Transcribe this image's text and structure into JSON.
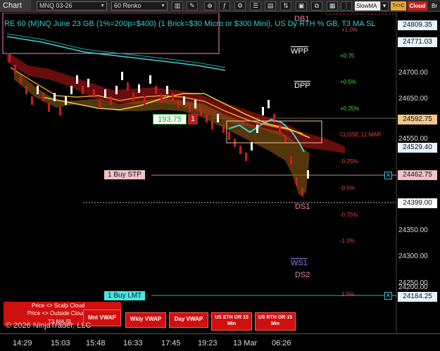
{
  "toolbar": {
    "chart_label": "Chart",
    "instrument": "MNQ 03-26",
    "timeframe": "60 Renko",
    "slowma_label": "SlowMA",
    "tc_label": "T<>C",
    "cloud_label": "Cloud",
    "br_label": "Br"
  },
  "chart": {
    "title": "RE 60 (M)NQ June 23 GB (1%=200p=$400) (1 Brick=$30 Micro or $300 Mini), US Dy RTH % GB, T3 MA SL",
    "percent_levels": [
      {
        "label": "+1.0%",
        "cls": "dn"
      },
      {
        "label": "+0.75",
        "cls": "up"
      },
      {
        "label": "+0.5%",
        "cls": "up"
      },
      {
        "label": "+0.25%",
        "cls": "up"
      },
      {
        "label": "CLOSE 12 MAR",
        "cls": "dn"
      },
      {
        "label": "-0.25%",
        "cls": "dn"
      },
      {
        "label": "-0.5%",
        "cls": "dn"
      },
      {
        "label": "-0.75%",
        "cls": "dn"
      },
      {
        "label": "-1.0%",
        "cls": "dn"
      },
      {
        "label": "1.5%",
        "cls": "dn"
      }
    ],
    "pivots": {
      "db1": "DB1",
      "wpp": "WPP",
      "dpp": "DPP",
      "ds1": "DS1",
      "ws1": "WS1",
      "ds2": "DS2"
    },
    "price_ticks": [
      "24700.00",
      "24650.00",
      "24550.00",
      "24500.00",
      "24350.00",
      "24300.00",
      "24250.00",
      "24200.00"
    ],
    "price_labels": [
      {
        "text": "24809.35",
        "bg": "#e8f4ff"
      },
      {
        "text": "24771.03",
        "bg": "#e8f4ff"
      },
      {
        "text": "24592.75",
        "bg": "#f0c88a"
      },
      {
        "text": "24529.40",
        "bg": "#e8f4ff"
      },
      {
        "text": "24462.75",
        "bg": "#f3c2c8"
      },
      {
        "text": "24399.00",
        "bg": "#ffffff"
      },
      {
        "text": "24184.25",
        "bg": "#e8f4ff"
      }
    ],
    "box_value": "193.75",
    "box_count": "1",
    "orders": {
      "buy_stp": "1 Buy STP",
      "buy_lmt": "1 Buy LMT"
    },
    "buttons": {
      "scalp_cloud": "Price <> Scalp Cloud",
      "outside_cloud": "Price <> Outside Cloud",
      "t3_ma_sl": "T3 MA SL",
      "mnt_vwap": "Mnt VWAP",
      "wkly_vwap": "Wkly VWAP",
      "day_vwap": "Day VWAP",
      "us_eth_or": "US ETH OR 15 Min",
      "us_rth_or": "US RTH OR 15 Min"
    },
    "copyright": "© 2026 NinjaTrader, LLC",
    "time_ticks": [
      "14:29",
      "15:03",
      "15:48",
      "16:33",
      "17:45",
      "19:23",
      "13 Mar",
      "06:26"
    ],
    "colors": {
      "bull_candle": "#ffffff",
      "bear_candle": "#d01a1a",
      "cloud": "#b01818",
      "ma_cyan": "#3ad0d8",
      "ma_orange": "#e89a2a",
      "ma_yellow": "#f0d040"
    }
  }
}
